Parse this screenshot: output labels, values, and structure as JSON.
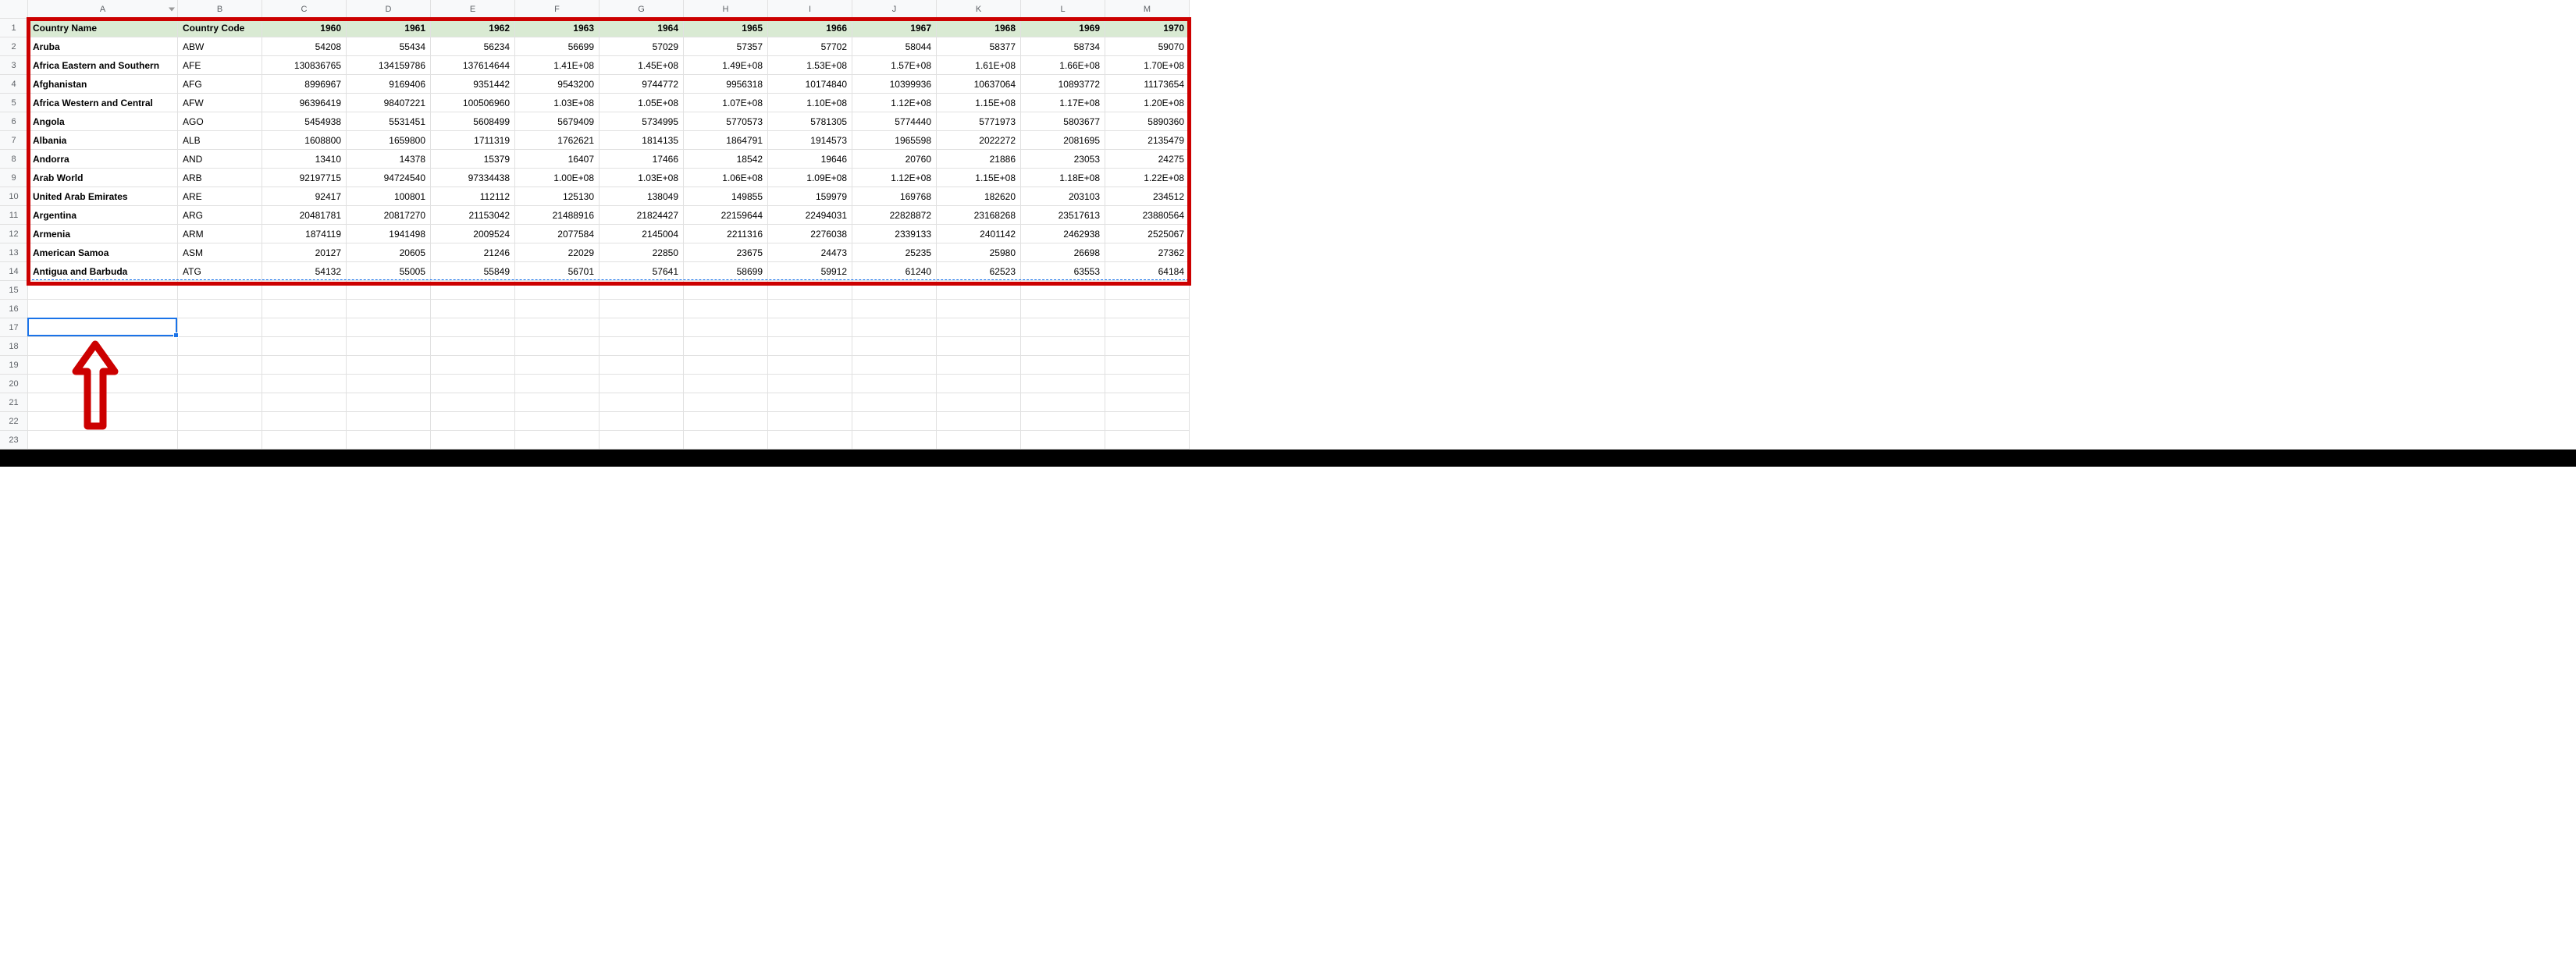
{
  "columns": [
    "A",
    "B",
    "C",
    "D",
    "E",
    "F",
    "G",
    "H",
    "I",
    "J",
    "K",
    "L",
    "M"
  ],
  "rowCount": 23,
  "headerRow": {
    "A": "Country Name",
    "B": "Country Code",
    "C": "1960",
    "D": "1961",
    "E": "1962",
    "F": "1963",
    "G": "1964",
    "H": "1965",
    "I": "1966",
    "J": "1967",
    "K": "1968",
    "L": "1969",
    "M": "1970"
  },
  "dataRows": [
    {
      "A": "Aruba",
      "B": "ABW",
      "C": "54208",
      "D": "55434",
      "E": "56234",
      "F": "56699",
      "G": "57029",
      "H": "57357",
      "I": "57702",
      "J": "58044",
      "K": "58377",
      "L": "58734",
      "M": "59070"
    },
    {
      "A": "Africa Eastern and Southern",
      "B": "AFE",
      "C": "130836765",
      "D": "134159786",
      "E": "137614644",
      "F": "1.41E+08",
      "G": "1.45E+08",
      "H": "1.49E+08",
      "I": "1.53E+08",
      "J": "1.57E+08",
      "K": "1.61E+08",
      "L": "1.66E+08",
      "M": "1.70E+08"
    },
    {
      "A": "Afghanistan",
      "B": "AFG",
      "C": "8996967",
      "D": "9169406",
      "E": "9351442",
      "F": "9543200",
      "G": "9744772",
      "H": "9956318",
      "I": "10174840",
      "J": "10399936",
      "K": "10637064",
      "L": "10893772",
      "M": "11173654"
    },
    {
      "A": "Africa Western and Central",
      "B": "AFW",
      "C": "96396419",
      "D": "98407221",
      "E": "100506960",
      "F": "1.03E+08",
      "G": "1.05E+08",
      "H": "1.07E+08",
      "I": "1.10E+08",
      "J": "1.12E+08",
      "K": "1.15E+08",
      "L": "1.17E+08",
      "M": "1.20E+08"
    },
    {
      "A": "Angola",
      "B": "AGO",
      "C": "5454938",
      "D": "5531451",
      "E": "5608499",
      "F": "5679409",
      "G": "5734995",
      "H": "5770573",
      "I": "5781305",
      "J": "5774440",
      "K": "5771973",
      "L": "5803677",
      "M": "5890360"
    },
    {
      "A": "Albania",
      "B": "ALB",
      "C": "1608800",
      "D": "1659800",
      "E": "1711319",
      "F": "1762621",
      "G": "1814135",
      "H": "1864791",
      "I": "1914573",
      "J": "1965598",
      "K": "2022272",
      "L": "2081695",
      "M": "2135479"
    },
    {
      "A": "Andorra",
      "B": "AND",
      "C": "13410",
      "D": "14378",
      "E": "15379",
      "F": "16407",
      "G": "17466",
      "H": "18542",
      "I": "19646",
      "J": "20760",
      "K": "21886",
      "L": "23053",
      "M": "24275"
    },
    {
      "A": "Arab World",
      "B": "ARB",
      "C": "92197715",
      "D": "94724540",
      "E": "97334438",
      "F": "1.00E+08",
      "G": "1.03E+08",
      "H": "1.06E+08",
      "I": "1.09E+08",
      "J": "1.12E+08",
      "K": "1.15E+08",
      "L": "1.18E+08",
      "M": "1.22E+08"
    },
    {
      "A": "United Arab Emirates",
      "B": "ARE",
      "C": "92417",
      "D": "100801",
      "E": "112112",
      "F": "125130",
      "G": "138049",
      "H": "149855",
      "I": "159979",
      "J": "169768",
      "K": "182620",
      "L": "203103",
      "M": "234512"
    },
    {
      "A": "Argentina",
      "B": "ARG",
      "C": "20481781",
      "D": "20817270",
      "E": "21153042",
      "F": "21488916",
      "G": "21824427",
      "H": "22159644",
      "I": "22494031",
      "J": "22828872",
      "K": "23168268",
      "L": "23517613",
      "M": "23880564"
    },
    {
      "A": "Armenia",
      "B": "ARM",
      "C": "1874119",
      "D": "1941498",
      "E": "2009524",
      "F": "2077584",
      "G": "2145004",
      "H": "2211316",
      "I": "2276038",
      "J": "2339133",
      "K": "2401142",
      "L": "2462938",
      "M": "2525067"
    },
    {
      "A": "American Samoa",
      "B": "ASM",
      "C": "20127",
      "D": "20605",
      "E": "21246",
      "F": "22029",
      "G": "22850",
      "H": "23675",
      "I": "24473",
      "J": "25235",
      "K": "25980",
      "L": "26698",
      "M": "27362"
    },
    {
      "A": "Antigua and Barbuda",
      "B": "ATG",
      "C": "54132",
      "D": "55005",
      "E": "55849",
      "F": "56701",
      "G": "57641",
      "H": "58699",
      "I": "59912",
      "J": "61240",
      "K": "62523",
      "L": "63553",
      "M": "64184"
    }
  ],
  "activeCell": "A17",
  "annotations": {
    "redBoxRange": "A1:M14",
    "arrowTargetCell": "A17"
  }
}
